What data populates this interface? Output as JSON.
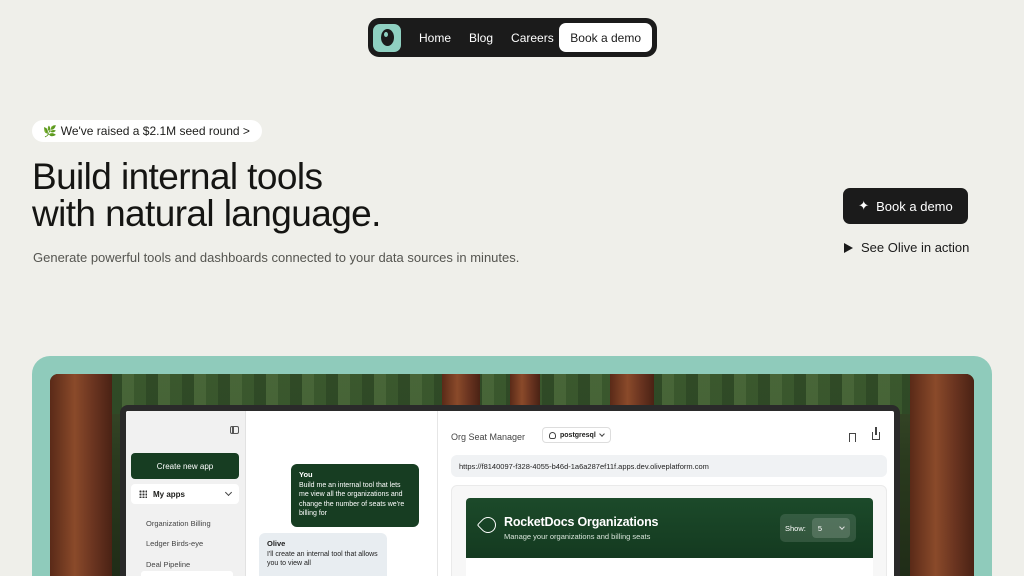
{
  "nav": {
    "links": [
      "Home",
      "Blog",
      "Careers"
    ],
    "cta": "Book a demo"
  },
  "hero": {
    "badge": "We've raised a $2.1M seed round >",
    "headline_line1": "Build internal tools",
    "headline_line2": "with natural language.",
    "subhead": "Generate powerful tools and dashboards connected to your data sources in minutes.",
    "primary_cta": "Book a demo",
    "secondary_cta": "See Olive in action"
  },
  "app": {
    "sidebar": {
      "new_app": "Create new app",
      "my_apps": "My apps",
      "items": [
        "Organization Billing",
        "Ledger Birds-eye",
        "Deal Pipeline"
      ]
    },
    "chat": {
      "user_name": "You",
      "user_message": "Build me an internal tool that lets me view all the organizations and change the number of seats we're billing for",
      "bot_name": "Olive",
      "bot_message": "I'll create an internal tool that allows you to view all"
    },
    "main": {
      "title": "Org Seat Manager",
      "db": "postgresql",
      "url": "https://f8140097-f328-4055-b46d-1a6a287ef11f.apps.dev.oliveplatform.com",
      "org_title": "RocketDocs Organizations",
      "org_subtitle": "Manage your organizations and billing seats",
      "show_label": "Show:",
      "show_value": "5"
    }
  },
  "colors": {
    "accent": "#8fcbbb",
    "dark_green": "#173d22",
    "nav_bg": "#1b1b1b"
  }
}
